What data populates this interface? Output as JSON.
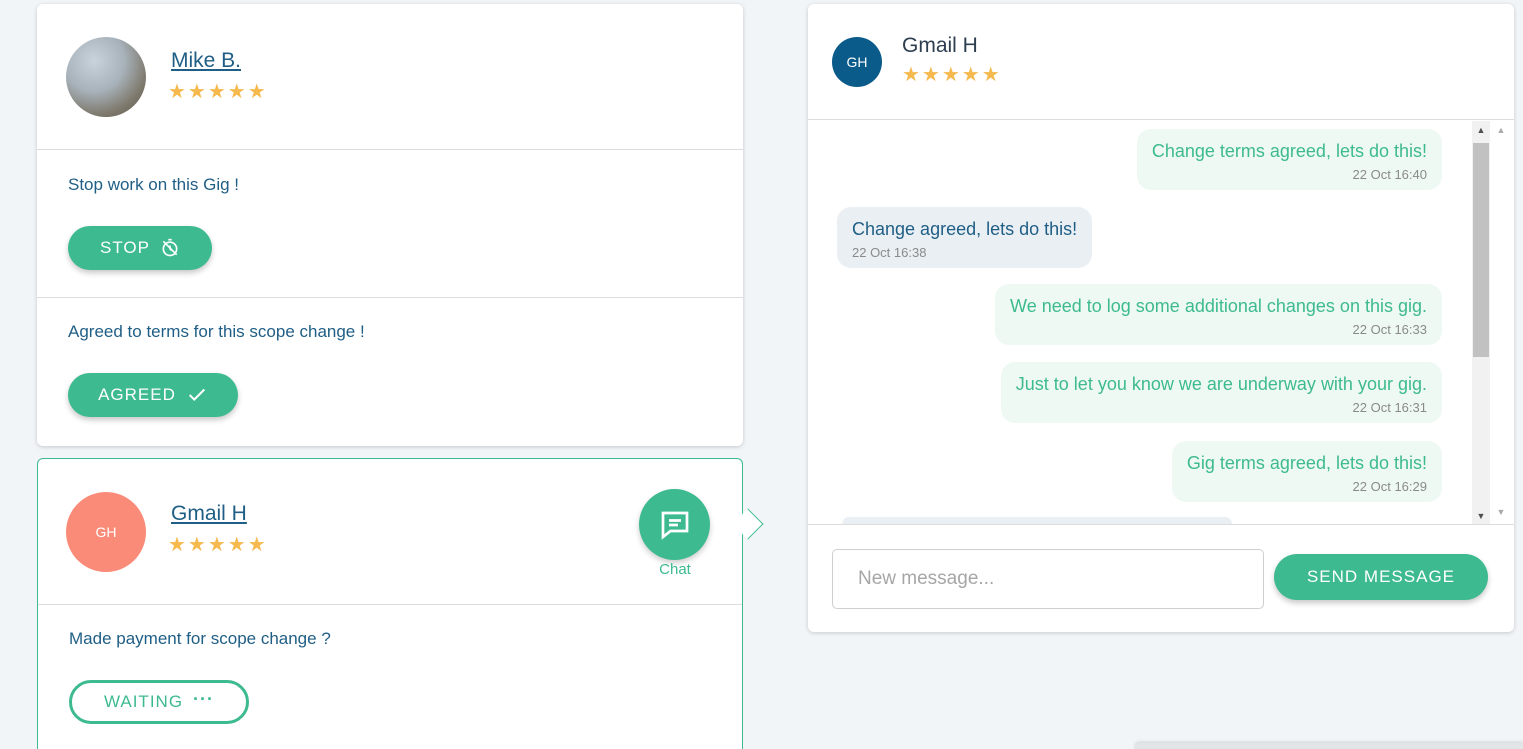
{
  "colors": {
    "accent": "#3dba90",
    "link": "#1f5e85",
    "star": "#f5b94e",
    "avatar_gh_salmon": "#f98b78",
    "avatar_gh_blue": "#0a5a8a"
  },
  "mike_card": {
    "name": "Mike B.",
    "stars": "★★★★★",
    "stop_section": {
      "text": "Stop work on this Gig !",
      "button_label": "STOP",
      "button_icon": "timer-off-icon"
    },
    "agreed_section": {
      "text": "Agreed to terms for this scope change !",
      "button_label": "AGREED",
      "button_icon": "checkmark-icon"
    }
  },
  "gmail_card": {
    "initials": "GH",
    "name": "Gmail H",
    "stars": "★★★★★",
    "chat_label": "Chat",
    "chat_icon": "chat-bubble-icon",
    "payment_section": {
      "text": "Made payment for scope change ?",
      "button_label": "WAITING",
      "button_icon": "more-dots-icon"
    }
  },
  "chat_panel": {
    "initials": "GH",
    "name": "Gmail H",
    "stars": "★★★★★",
    "messages": [
      {
        "direction": "out",
        "text": "Change terms agreed, lets do this!",
        "time": "22 Oct 16:40"
      },
      {
        "direction": "in",
        "text": "Change agreed, lets do this!",
        "time": "22 Oct 16:38"
      },
      {
        "direction": "out",
        "text": "We need to log some additional changes on this gig.",
        "time": "22 Oct 16:33"
      },
      {
        "direction": "out",
        "text": "Just to let you know we are underway with your gig.",
        "time": "22 Oct 16:31"
      },
      {
        "direction": "out",
        "text": "Gig terms agreed, lets do this!",
        "time": "22 Oct 16:29"
      }
    ],
    "compose_placeholder": "New message...",
    "send_label": "SEND MESSAGE"
  }
}
